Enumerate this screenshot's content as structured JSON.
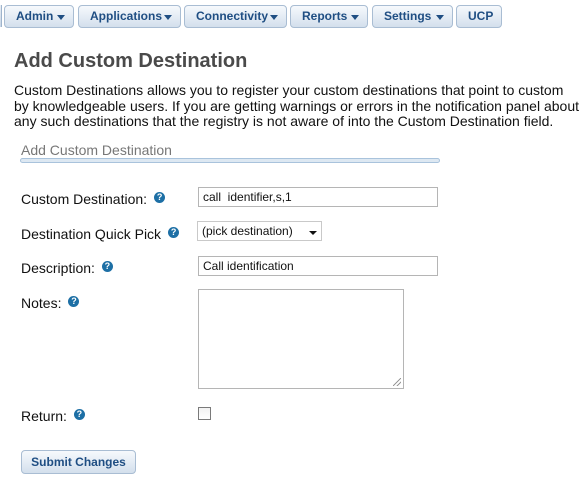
{
  "menu": {
    "items": [
      {
        "label": "Admin"
      },
      {
        "label": "Applications"
      },
      {
        "label": "Connectivity"
      },
      {
        "label": "Reports"
      },
      {
        "label": "Settings"
      },
      {
        "label": "UCP"
      }
    ]
  },
  "page": {
    "title": "Add Custom Destination",
    "description_lines": [
      "Custom Destinations allows you to register your custom destinations that point to custom",
      "by knowledgeable users. If you are getting warnings or errors in the notification panel about",
      "any such destinations that the registry is not aware of into the Custom Destination field."
    ]
  },
  "form": {
    "section_heading": "Add Custom Destination",
    "help_glyph": "?",
    "custom_destination": {
      "label": "Custom Destination:",
      "value": "call  identifier,s,1"
    },
    "quick_pick": {
      "label": "Destination Quick Pick",
      "selected": "(pick destination)"
    },
    "description": {
      "label": "Description:",
      "value": "Call identification"
    },
    "notes": {
      "label": "Notes:",
      "value": ""
    },
    "return": {
      "label": "Return:",
      "checked": false
    },
    "submit_label": "Submit Changes"
  },
  "colors": {
    "menu_text": "#1f4e83",
    "help_icon": "#1d6fa5",
    "title": "#4a4a4a"
  }
}
